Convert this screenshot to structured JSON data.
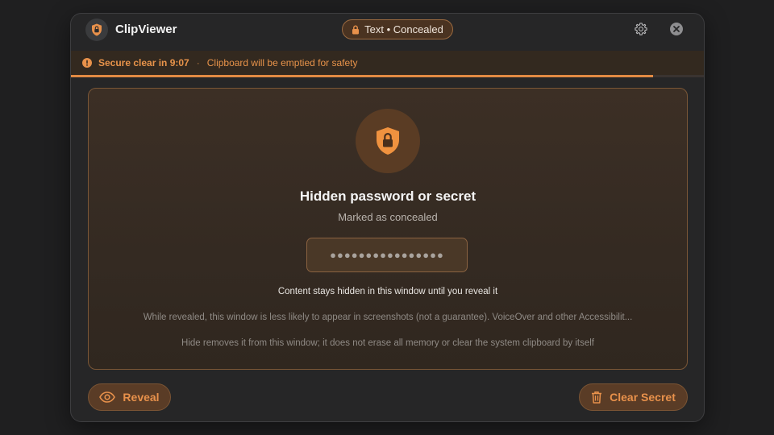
{
  "app": {
    "title": "ClipViewer",
    "type_pill_label": "Text • Concealed"
  },
  "banner": {
    "countdown_label": "Secure clear in 9:07",
    "separator": "·",
    "message": "Clipboard will be emptied for safety",
    "progress_fraction": 0.92
  },
  "card": {
    "title": "Hidden password or secret",
    "subtitle": "Marked as concealed",
    "masked_value": "●●●●●●●●●●●●●●●●",
    "hint": "Content stays hidden in this window until you reveal it",
    "note_1": "While revealed, this window is less likely to appear in screenshots (not a guarantee). VoiceOver and other Accessibilit...",
    "note_2": "Hide removes it from this window; it does not erase all memory or clear the system clipboard by itself"
  },
  "actions": {
    "reveal_label": "Reveal",
    "clear_label": "Clear Secret"
  },
  "icons": {
    "app": "shield-lock-icon",
    "pill": "lock-icon",
    "settings": "gear-icon",
    "close": "close-icon",
    "warning": "exclamation-icon",
    "card": "shield-lock-icon",
    "reveal": "eye-icon",
    "clear": "trash-icon"
  },
  "colors": {
    "accent": "#e8914b",
    "background": "#1f1f20",
    "window": "#262627"
  }
}
